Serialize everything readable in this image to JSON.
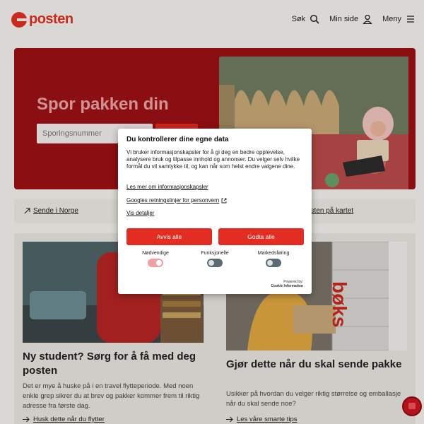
{
  "header": {
    "logo_text": "posten",
    "nav": [
      {
        "label": "Søk",
        "icon": "search-icon"
      },
      {
        "label": "Min side",
        "icon": "user-icon"
      },
      {
        "label": "Meny",
        "icon": "menu-icon"
      }
    ]
  },
  "hero": {
    "title": "Spor pakken din",
    "input_placeholder": "Sporingsnummer"
  },
  "linkbar": {
    "items": [
      {
        "label": "Sende i Norge"
      },
      {
        "label": "osten på kartet"
      }
    ]
  },
  "cards": [
    {
      "title": "Ny student? Sørg for å få med deg posten",
      "text": "Det er mye å huske på i en travel flytteperiode. Med noen enkle grep sikrer du at brev og pakker kommer frem til riktig adresse fra første dag.",
      "link": "Husk dette når du flytter"
    },
    {
      "title": "Gjør dette når du skal sende pakke",
      "text": "Usikker på hvordan du velger riktig størrelse og emballasje når du skal sende noe?",
      "link": "Les våre smarte tips",
      "image_text": "bøks"
    }
  ],
  "cookie_dialog": {
    "title": "Du kontrollerer dine egne data",
    "body": "Vi bruker informasjonskapsler for å gi deg en bedre opplevelse, analysere bruk og tilpasse innhold og annonser. Du velger selv hvilke formål du vil samtykke til, og kan når som helst endre valgene dine.",
    "link_cookies": "Les mer om informasjonskapsler",
    "link_google": "Googles retningslinjer for personvern",
    "link_details": "Vis detaljer",
    "reject_label": "Avvis alle",
    "accept_label": "Godta alle",
    "toggles": [
      {
        "label": "Nødvendige",
        "state": "on-disabled"
      },
      {
        "label": "Funksjonelle",
        "state": "off"
      },
      {
        "label": "Markedsføring",
        "state": "off"
      }
    ],
    "powered_by": "Powered by:",
    "powered_name": "Cookie Information"
  },
  "colors": {
    "brand_red": "#e32d22",
    "hero_bg": "#9b1016"
  }
}
